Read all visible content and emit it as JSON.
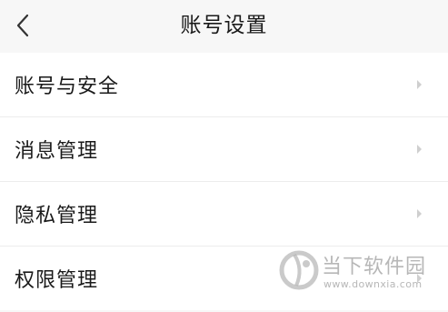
{
  "header": {
    "title": "账号设置",
    "back_icon": "chevron-left-icon"
  },
  "menu": {
    "items": [
      {
        "label": "账号与安全",
        "icon": "chevron-right-icon"
      },
      {
        "label": "消息管理",
        "icon": "chevron-right-icon"
      },
      {
        "label": "隐私管理",
        "icon": "chevron-right-icon"
      },
      {
        "label": "权限管理",
        "icon": "chevron-right-icon"
      }
    ]
  },
  "watermark": {
    "text": "当下软件园",
    "url": "www.downxia.com"
  },
  "colors": {
    "background": "#f7f7f7",
    "list_background": "#ffffff",
    "divider": "#ececec",
    "text": "#1a1a1a",
    "chevron": "#cfcfcf"
  }
}
